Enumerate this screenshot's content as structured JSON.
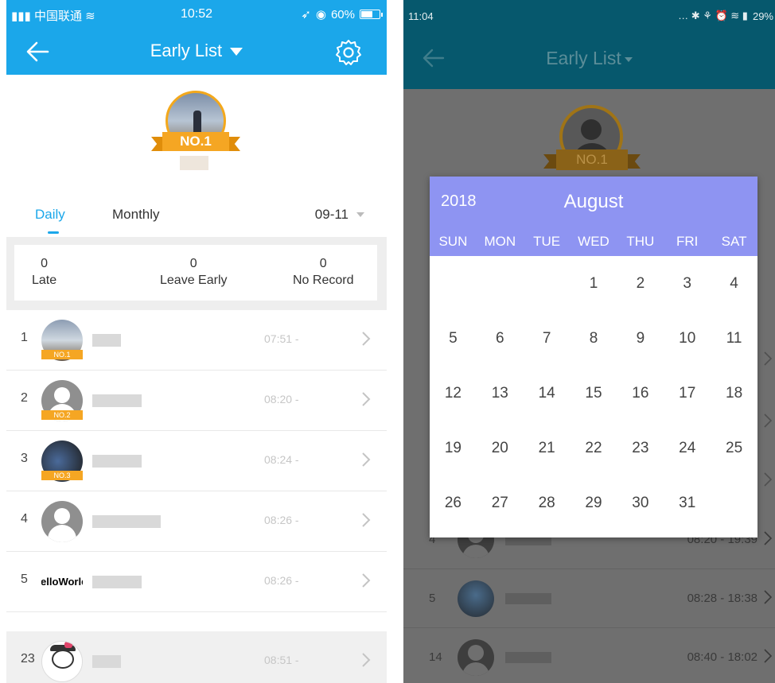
{
  "left_screen": {
    "status_bar": {
      "carrier": "中国联通",
      "time": "10:52",
      "battery": "60%"
    },
    "nav": {
      "title": "Early List"
    },
    "winner": {
      "badge": "NO.1"
    },
    "tabs": {
      "daily": "Daily",
      "monthly": "Monthly",
      "date": "09-11"
    },
    "stats": [
      {
        "value": "0",
        "label": "Late"
      },
      {
        "value": "0",
        "label": "Leave Early"
      },
      {
        "value": "0",
        "label": "No Record"
      }
    ],
    "rows": [
      {
        "rank": "1",
        "time": "07:51 -",
        "badge": "NO.1"
      },
      {
        "rank": "2",
        "time": "08:20 -",
        "badge": "NO.2"
      },
      {
        "rank": "3",
        "time": "08:24 -",
        "badge": "NO.3"
      },
      {
        "rank": "4",
        "time": "08:26 -"
      },
      {
        "rank": "5",
        "time": "08:26 -",
        "avatar_text": "Hello World!"
      },
      {
        "rank": "23",
        "time": "08:51 -"
      }
    ]
  },
  "right_screen": {
    "status_bar": {
      "time": "11:04",
      "battery": "29%"
    },
    "nav": {
      "title": "Early List"
    },
    "winner": {
      "badge": "NO.1"
    },
    "rows": [
      {
        "rank": "4",
        "time": "08:20 - 19:39"
      },
      {
        "rank": "5",
        "time": "08:28 - 18:38"
      },
      {
        "rank": "14",
        "time": "08:40 - 18:02"
      }
    ],
    "calendar": {
      "year": "2018",
      "month": "August",
      "weekdays": [
        "SUN",
        "MON",
        "TUE",
        "WED",
        "THU",
        "FRI",
        "SAT"
      ],
      "days": [
        "",
        "",
        "",
        "1",
        "2",
        "3",
        "4",
        "5",
        "6",
        "7",
        "8",
        "9",
        "10",
        "11",
        "12",
        "13",
        "14",
        "15",
        "16",
        "17",
        "18",
        "19",
        "20",
        "21",
        "22",
        "23",
        "24",
        "25",
        "26",
        "27",
        "28",
        "29",
        "30",
        "31",
        ""
      ]
    }
  },
  "colors": {
    "left_header": "#1ba7ea",
    "right_header": "#06586d",
    "calendar_header": "#8e94f2",
    "badge_gold": "#f5a623"
  }
}
